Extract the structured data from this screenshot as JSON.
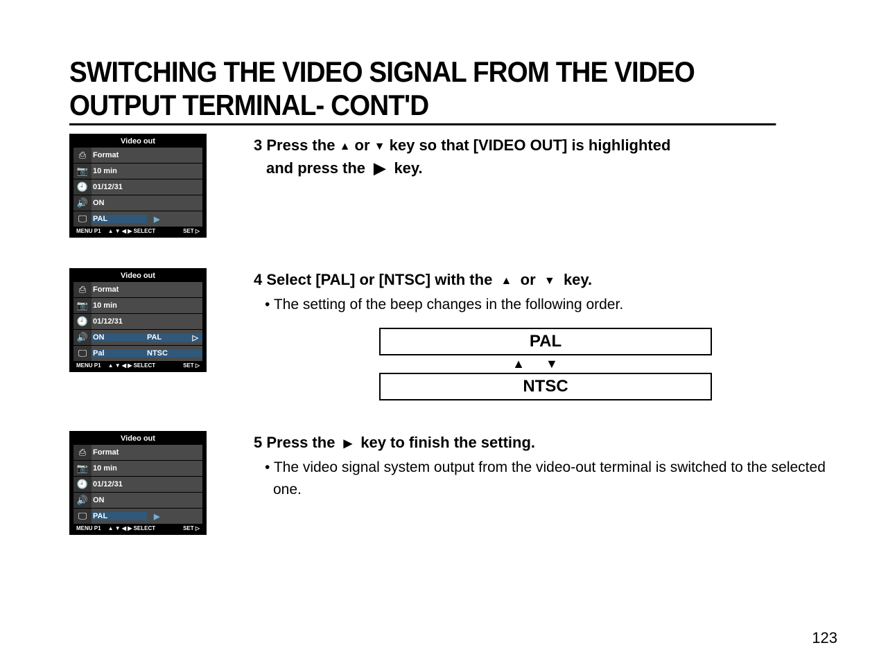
{
  "page": {
    "title": "SWITCHING THE VIDEO SIGNAL FROM THE VIDEO OUTPUT TERMINAL- CONT'D",
    "number": "123"
  },
  "screens": {
    "title": "Video out",
    "menubar": {
      "left": "MENU P1",
      "mid": "▲ ▼ ◀ ▶ SELECT",
      "right": "SET ▷"
    },
    "rows_common": {
      "format": "Format",
      "tenmin": "10 min",
      "date": "01/12/31",
      "on": "ON"
    },
    "s3_last": {
      "label": "PAL",
      "arrow": "▶"
    },
    "s4_row4": {
      "label": "ON",
      "col3": "PAL",
      "col3_arrow": "▷"
    },
    "s4_row5": {
      "label": "Pal",
      "col3": "NTSC"
    },
    "s5_last": {
      "label": "PAL",
      "arrow": "▶"
    }
  },
  "step3": {
    "num": "3",
    "line1a": "Press the",
    "line1b": "or",
    "line1c": "key so that [VIDEO OUT] is highlighted",
    "line2a": "and press the",
    "line2b": "key."
  },
  "step4": {
    "num": "4",
    "line1a": "Select  [PAL] or [NTSC] with the",
    "line1b": "or",
    "line1c": "key.",
    "bullet": "The setting of the beep changes in the following order.",
    "opt1": "PAL",
    "opt2": "NTSC",
    "arrows": "▲ ▼"
  },
  "step5": {
    "num": "5",
    "line1a": "Press the",
    "line1b": "key to finish the setting.",
    "bullet": "The video signal system output from the video-out terminal is switched to the selected one."
  }
}
